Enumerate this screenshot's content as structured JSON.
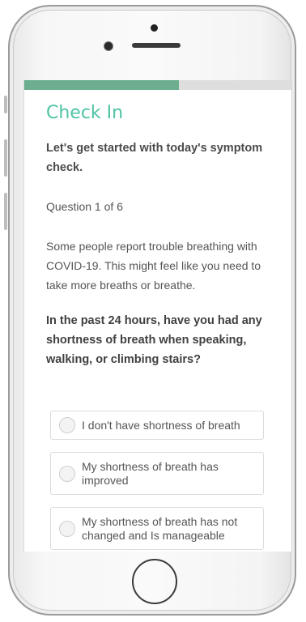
{
  "progress": {
    "fraction": 0.58
  },
  "header": {
    "title": "Check In"
  },
  "intro": {
    "text": "Let's get started with today's symptom check."
  },
  "question_counter": "Question 1 of 6",
  "description": "Some people report trouble breathing with COVID-19. This might feel like you need to take more breaths or breathe.",
  "question": "In the past 24 hours, have you had any shortness of breath when speaking, walking, or climbing stairs?",
  "options": [
    {
      "label": "I don't have shortness of breath"
    },
    {
      "label": "My shortness of breath has improved"
    },
    {
      "label": "My shortness of breath has not changed and Is manageable"
    }
  ],
  "colors": {
    "accent": "#4fc3a6",
    "progress": "#6dae8e",
    "track": "#dedede"
  },
  "icons": {
    "home": "home-button",
    "radio": "radio-unchecked-icon"
  }
}
